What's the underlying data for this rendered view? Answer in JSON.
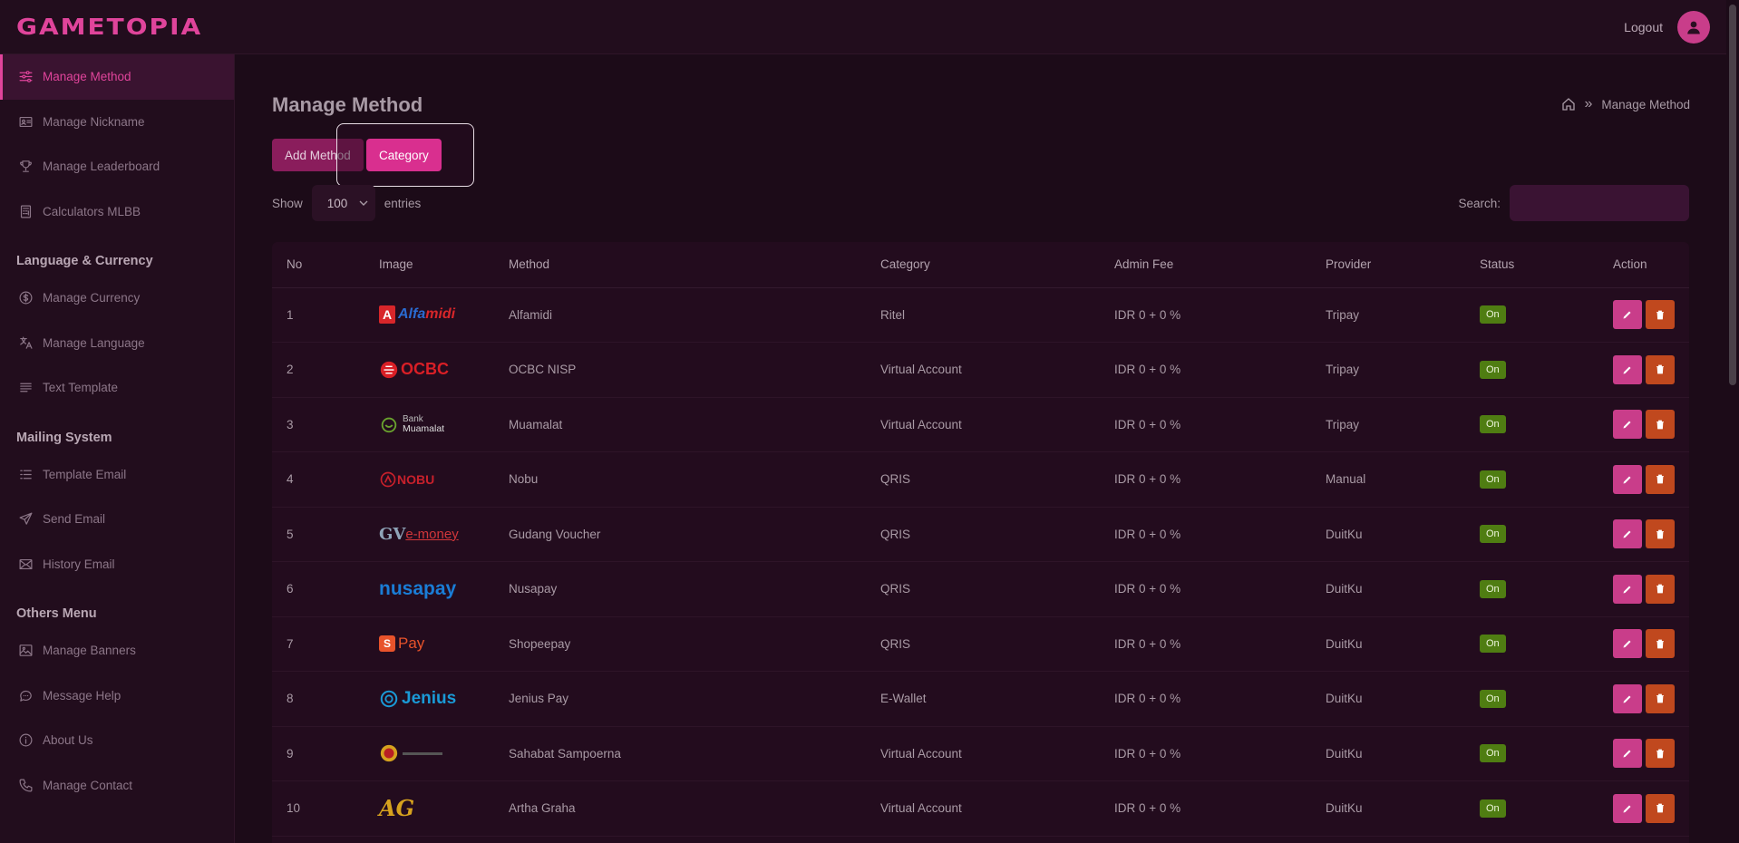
{
  "header": {
    "logo": "GAMETOPIA",
    "logout": "Logout"
  },
  "sidebar": {
    "items_top": [
      {
        "label": "Manage Method",
        "icon": "sliders-icon",
        "active": true
      },
      {
        "label": "Manage Nickname",
        "icon": "id-card-icon"
      },
      {
        "label": "Manage Leaderboard",
        "icon": "trophy-icon"
      },
      {
        "label": "Calculators MLBB",
        "icon": "calculator-icon"
      }
    ],
    "section_lang": "Language & Currency",
    "items_lang": [
      {
        "label": "Manage Currency",
        "icon": "dollar-icon"
      },
      {
        "label": "Manage Language",
        "icon": "translate-icon"
      },
      {
        "label": "Text Template",
        "icon": "text-lines-icon"
      }
    ],
    "section_mail": "Mailing System",
    "items_mail": [
      {
        "label": "Template Email",
        "icon": "list-icon"
      },
      {
        "label": "Send Email",
        "icon": "send-icon"
      },
      {
        "label": "History Email",
        "icon": "mail-icon"
      }
    ],
    "section_others": "Others Menu",
    "items_others": [
      {
        "label": "Manage Banners",
        "icon": "image-icon"
      },
      {
        "label": "Message Help",
        "icon": "chat-icon"
      },
      {
        "label": "About Us",
        "icon": "info-icon"
      },
      {
        "label": "Manage Contact",
        "icon": "phone-icon"
      }
    ]
  },
  "main": {
    "title": "Manage Method",
    "breadcrumb": {
      "separator": "»",
      "current": "Manage Method"
    },
    "buttons": {
      "add": "Add Method",
      "category": "Category"
    },
    "show_label": "Show",
    "entries_value": "100",
    "entries_label": "entries",
    "search_label": "Search:",
    "columns": [
      "No",
      "Image",
      "Method",
      "Category",
      "Admin Fee",
      "Provider",
      "Status",
      "Action"
    ],
    "rows": [
      {
        "no": "1",
        "logo": "alfamidi",
        "method": "Alfamidi",
        "category": "Ritel",
        "fee": "IDR 0 + 0 %",
        "provider": "Tripay",
        "status": "On"
      },
      {
        "no": "2",
        "logo": "ocbc",
        "method": "OCBC NISP",
        "category": "Virtual Account",
        "fee": "IDR 0 + 0 %",
        "provider": "Tripay",
        "status": "On"
      },
      {
        "no": "3",
        "logo": "muamalat",
        "method": "Muamalat",
        "category": "Virtual Account",
        "fee": "IDR 0 + 0 %",
        "provider": "Tripay",
        "status": "On"
      },
      {
        "no": "4",
        "logo": "nobu",
        "method": "Nobu",
        "category": "QRIS",
        "fee": "IDR 0 + 0 %",
        "provider": "Manual",
        "status": "On"
      },
      {
        "no": "5",
        "logo": "gvmoney",
        "method": "Gudang Voucher",
        "category": "QRIS",
        "fee": "IDR 0 + 0 %",
        "provider": "DuitKu",
        "status": "On"
      },
      {
        "no": "6",
        "logo": "nusapay",
        "method": "Nusapay",
        "category": "QRIS",
        "fee": "IDR 0 + 0 %",
        "provider": "DuitKu",
        "status": "On"
      },
      {
        "no": "7",
        "logo": "shopeepay",
        "method": "Shopeepay",
        "category": "QRIS",
        "fee": "IDR 0 + 0 %",
        "provider": "DuitKu",
        "status": "On"
      },
      {
        "no": "8",
        "logo": "jenius",
        "method": "Jenius Pay",
        "category": "E-Wallet",
        "fee": "IDR 0 + 0 %",
        "provider": "DuitKu",
        "status": "On"
      },
      {
        "no": "9",
        "logo": "sampoerna",
        "method": "Sahabat Sampoerna",
        "category": "Virtual Account",
        "fee": "IDR 0 + 0 %",
        "provider": "DuitKu",
        "status": "On"
      },
      {
        "no": "10",
        "logo": "arthagraha",
        "method": "Artha Graha",
        "category": "Virtual Account",
        "fee": "IDR 0 + 0 %",
        "provider": "DuitKu",
        "status": "On"
      }
    ],
    "logo_text": {
      "alfamidi_a": "A",
      "alfamidi_b": "Alfa",
      "alfamidi_c": "midi",
      "ocbc": "OCBC",
      "muamalat_1": "Bank",
      "muamalat_2": "Muamalat",
      "nobu": "NOBU",
      "gv_1": "GV",
      "gv_2": "e-money",
      "nusapay": "nusapay",
      "shopee_1": "S",
      "shopee_2": "Pay",
      "jenius": "Jenius",
      "ag": "AG"
    }
  },
  "colors": {
    "accent": "#e0449b",
    "status_on": "#4f7d12",
    "delete": "#c0481e"
  }
}
